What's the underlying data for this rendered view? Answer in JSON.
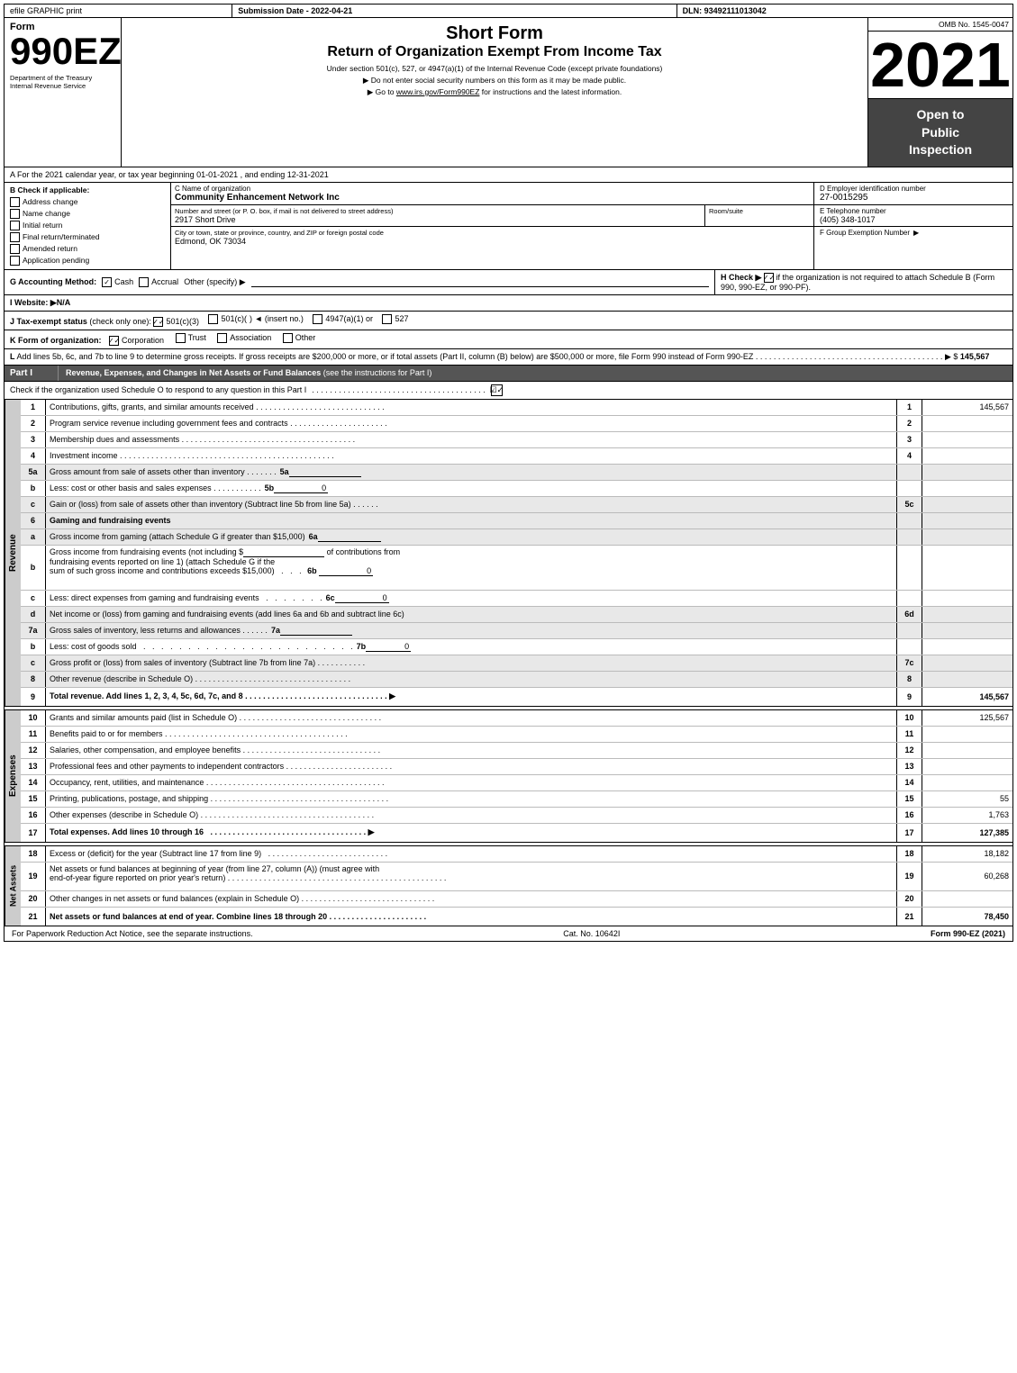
{
  "header": {
    "efile_label": "efile GRAPHIC print",
    "submission_label": "Submission Date - 2022-04-21",
    "dln_label": "DLN: 93492111013042"
  },
  "form": {
    "number": "990EZ",
    "short_form_title": "Short Form",
    "return_title": "Return of Organization Exempt From Income Tax",
    "under_section": "Under section 501(c), 527, or 4947(a)(1) of the Internal Revenue Code (except private foundations)",
    "no_ssn": "▶ Do not enter social security numbers on this form as it may be made public.",
    "goto": "▶ Go to www.irs.gov/Form990EZ for instructions and the latest information.",
    "goto_link": "www.irs.gov/Form990EZ",
    "year": "2021",
    "omb": "OMB No. 1545-0047",
    "open_to_public": "Open to\nPublic\nInspection",
    "dept": "Department of the Treasury\nInternal Revenue Service"
  },
  "section_a": {
    "label": "A  For the 2021 calendar year, or tax year beginning 01-01-2021 , and ending 12-31-2021"
  },
  "section_b": {
    "label": "B  Check if applicable:",
    "address_change": "Address change",
    "name_change": "Name change",
    "initial_return": "Initial return",
    "final_return": "Final return/terminated",
    "amended_return": "Amended return",
    "application_pending": "Application pending"
  },
  "org": {
    "c_label": "C Name of organization",
    "name": "Community Enhancement Network Inc",
    "address_label": "Number and street (or P. O. box, if mail is not delivered to street address)",
    "address": "2917 Short Drive",
    "room_label": "Room/suite",
    "city_label": "City or town, state or province, country, and ZIP or foreign postal code",
    "city": "Edmond, OK  73034",
    "d_label": "D Employer identification number",
    "ein": "27-0015295",
    "e_label": "E Telephone number",
    "phone": "(405) 348-1017",
    "f_label": "F Group Exemption Number",
    "f_arrow": "▶"
  },
  "section_g": {
    "label": "G Accounting Method:",
    "cash_label": "Cash",
    "cash_checked": true,
    "accrual_label": "Accrual",
    "other_label": "Other (specify) ▶"
  },
  "section_h": {
    "label": "H  Check ▶",
    "check_label": "✓",
    "text": "if the organization is not required to attach Schedule B (Form 990, 990-EZ, or 990-PF)."
  },
  "section_i": {
    "label": "I Website: ▶N/A"
  },
  "section_j": {
    "label": "J Tax-exempt status",
    "check_only": "(check only one):",
    "options": [
      "501(c)(3)",
      "501(c)(",
      ") ◄ (insert no.)",
      "4947(a)(1) or",
      "527"
    ],
    "checked": "501(c)(3)"
  },
  "section_k": {
    "label": "K Form of organization:",
    "corporation_label": "Corporation",
    "corporation_checked": true,
    "trust_label": "Trust",
    "association_label": "Association",
    "other_label": "Other"
  },
  "section_l": {
    "text": "L Add lines 5b, 6c, and 7b to line 9 to determine gross receipts. If gross receipts are $200,000 or more, or if total assets (Part II, column (B) below) are $500,000 or more, file Form 990 instead of Form 990-EZ",
    "dots": ". . . . . . . . . . . . . . . . . . . . . . . . . . . . . . . . . . . . . . . . . .",
    "arrow": "▶ $",
    "value": "145,567"
  },
  "part1": {
    "header": "Part I",
    "title": "Revenue, Expenses, and Changes in Net Assets or Fund Balances",
    "see_instructions": "(see the instructions for Part I)",
    "check_schedule_o": "Check if the organization used Schedule O to respond to any question in this Part I",
    "dots": ". . . . . . . . . . . . . . . . . . . . . . . . . . . . . . . . .",
    "check_mark": "☑",
    "rows": [
      {
        "num": "1",
        "desc": "Contributions, gifts, grants, and similar amounts received",
        "dots": ". . . . . . . . . . . . . . . . . . . . . . . . . . . .",
        "col": "1",
        "value": "145,567",
        "shaded": false
      },
      {
        "num": "2",
        "desc": "Program service revenue including government fees and contracts",
        "dots": ". . . . . . . . . . . . . . . . . . . . . .",
        "col": "2",
        "value": "",
        "shaded": false
      },
      {
        "num": "3",
        "desc": "Membership dues and assessments",
        "dots": ". . . . . . . . . . . . . . . . . . . . . . . . . . . . . . . . . . . . . .",
        "col": "3",
        "value": "",
        "shaded": false
      },
      {
        "num": "4",
        "desc": "Investment income",
        "dots": ". . . . . . . . . . . . . . . . . . . . . . . . . . . . . . . . . . . . . . . . . . . . . . . .",
        "col": "4",
        "value": "",
        "shaded": false
      }
    ],
    "row5a": {
      "num": "5a",
      "desc": "Gross amount from sale of assets other than inventory",
      "dots": ". . . . . . .",
      "subcol": "5a",
      "value": "",
      "shaded": true
    },
    "row5b": {
      "num": "b",
      "desc": "Less: cost or other basis and sales expenses",
      "dots": ". . . . . . . . . . .",
      "subcol": "5b",
      "value": "0",
      "shaded": false
    },
    "row5c": {
      "num": "c",
      "desc": "Gain or (loss) from sale of assets other than inventory (Subtract line 5b from line 5a)",
      "dots": ". . . . . .",
      "col": "5c",
      "value": "",
      "shaded": true
    },
    "row6_header": {
      "num": "6",
      "desc": "Gaming and fundraising events",
      "shaded": true
    },
    "row6a": {
      "num": "a",
      "desc": "Gross income from gaming (attach Schedule G if greater than $15,000)",
      "subcol": "6a",
      "value": "",
      "shaded": true
    },
    "row6b_desc": "Gross income from fundraising events (not including $",
    "row6b_blank": "________________",
    "row6b_of": "of contributions from",
    "row6b_cont": "fundraising events reported on line 1) (attach Schedule G if the",
    "row6b_cont2": "sum of such gross income and contributions exceeds $15,000)",
    "row6b_dots": "  .  .  .",
    "row6b_subcol": "6b",
    "row6b_value": "0",
    "row6c": {
      "num": "c",
      "desc": "Less: direct expenses from gaming and fundraising events",
      "dots": "  .  .  .  .  .  .  .",
      "subcol": "6c",
      "value": "0",
      "shaded": false
    },
    "row6d": {
      "num": "d",
      "desc": "Net income or (loss) from gaming and fundraising events (add lines 6a and 6b and subtract line 6c)",
      "col": "6d",
      "value": "",
      "shaded": true
    },
    "row7a": {
      "num": "7a",
      "desc": "Gross sales of inventory, less returns and allowances",
      "dots": ". . . . . .",
      "subcol": "7a",
      "value": "",
      "shaded": true
    },
    "row7b": {
      "num": "b",
      "desc": "Less: cost of goods sold",
      "dots": ". . . . . . . . . . . . . . . . . . . . . . . . .",
      "subcol": "7b",
      "value": "0",
      "shaded": false
    },
    "row7c": {
      "num": "c",
      "desc": "Gross profit or (loss) from sales of inventory (Subtract line 7b from line 7a)",
      "dots": ". . . . . . . . . . .",
      "col": "7c",
      "value": "",
      "shaded": true
    },
    "row8": {
      "num": "8",
      "desc": "Other revenue (describe in Schedule O)",
      "dots": ". . . . . . . . . . . . . . . . . . . . . . . . . . . . . . . . . . .",
      "col": "8",
      "value": "",
      "shaded": true
    },
    "row9": {
      "num": "9",
      "desc": "Total revenue. Add lines 1, 2, 3, 4, 5c, 6d, 7c, and 8",
      "dots": ". . . . . . . . . . . . . . . . . . . . . . . . . . . . . . . .",
      "arrow": "▶",
      "col": "9",
      "value": "145,567",
      "shaded": false,
      "bold": true
    }
  },
  "expenses": {
    "rows": [
      {
        "num": "10",
        "desc": "Grants and similar amounts paid (list in Schedule O)",
        "dots": ". . . . . . . . . . . . . . . . . . . . . . . . . . . . . . . .",
        "col": "10",
        "value": "125,567",
        "shaded": false
      },
      {
        "num": "11",
        "desc": "Benefits paid to or for members",
        "dots": ". . . . . . . . . . . . . . . . . . . . . . . . . . . . . . . . . . . . . . . . .",
        "col": "11",
        "value": "",
        "shaded": false
      },
      {
        "num": "12",
        "desc": "Salaries, other compensation, and employee benefits",
        "dots": ". . . . . . . . . . . . . . . . . . . . . . . . . . . . . . .",
        "col": "12",
        "value": "",
        "shaded": false
      },
      {
        "num": "13",
        "desc": "Professional fees and other payments to independent contractors",
        "dots": ". . . . . . . . . . . . . . . . . . . . . . . . .",
        "col": "13",
        "value": "",
        "shaded": false
      },
      {
        "num": "14",
        "desc": "Occupancy, rent, utilities, and maintenance",
        "dots": ". . . . . . . . . . . . . . . . . . . . . . . . . . . . . . . . . . . . . . . .",
        "col": "14",
        "value": "",
        "shaded": false
      },
      {
        "num": "15",
        "desc": "Printing, publications, postage, and shipping",
        "dots": ". . . . . . . . . . . . . . . . . . . . . . . . . . . . . . . . . . . . . . . .",
        "col": "15",
        "value": "55",
        "shaded": false
      },
      {
        "num": "16",
        "desc": "Other expenses (describe in Schedule O)",
        "dots": ". . . . . . . . . . . . . . . . . . . . . . . . . . . . . . . . . . . . . . .",
        "col": "16",
        "value": "1,763",
        "shaded": false
      },
      {
        "num": "17",
        "desc": "Total expenses. Add lines 10 through 16",
        "dots": ". . . . . . . . . . . . . . . . . . . . . . . . . . . . . . . . . . . .",
        "arrow": "▶",
        "col": "17",
        "value": "127,385",
        "shaded": false,
        "bold": true
      }
    ]
  },
  "net_assets": {
    "rows": [
      {
        "num": "18",
        "desc": "Excess or (deficit) for the year (Subtract line 17 from line 9)",
        "dots": ". . . . . . . . . . . . . . . . . . . . . . . . . . .",
        "col": "18",
        "value": "18,182",
        "shaded": false
      },
      {
        "num": "19",
        "desc": "Net assets or fund balances at beginning of year (from line 27, column (A)) (must agree with end-of-year figure reported on prior year's return)",
        "dots": ". . . . . . . . . . . . . . . . . . . . . . . . . . . . . . . . . . . . . . . . . . . . . . . . . .",
        "col": "19",
        "value": "60,268",
        "shaded": false
      },
      {
        "num": "20",
        "desc": "Other changes in net assets or fund balances (explain in Schedule O)",
        "dots": ". . . . . . . . . . . . . . . . . . . . . . . . . . . . . . .",
        "col": "20",
        "value": "",
        "shaded": false
      },
      {
        "num": "21",
        "desc": "Net assets or fund balances at end of year. Combine lines 18 through 20",
        "dots": ". . . . . . . . . . . . . . . . . . . . . . .",
        "col": "21",
        "value": "78,450",
        "shaded": false,
        "bold": true
      }
    ]
  },
  "footer": {
    "paperwork": "For Paperwork Reduction Act Notice, see the separate instructions.",
    "cat_no": "Cat. No. 10642I",
    "form_label": "Form 990-EZ (2021)"
  }
}
